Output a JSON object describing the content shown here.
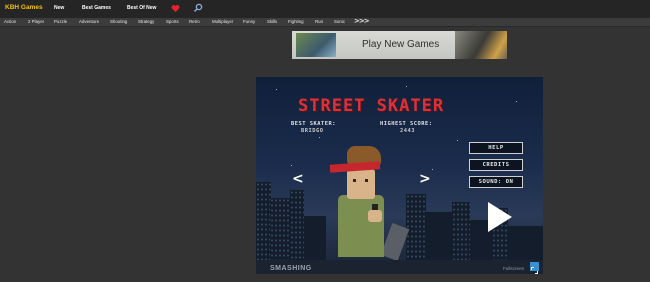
{
  "header": {
    "logo": "KBH Games",
    "nav": [
      {
        "label": "New"
      },
      {
        "label": "Best Games"
      },
      {
        "label": "Best Of New"
      }
    ],
    "favorites_icon": "heart-icon",
    "search_icon": "search-icon"
  },
  "categories": [
    "Action",
    "2 Player",
    "Puzzle",
    "Adventure",
    "Shooting",
    "Strategy",
    "Sports",
    "Retro",
    "Multiplayer",
    "Funny",
    "Skills",
    "Fighting",
    "Run",
    "Sonic"
  ],
  "more_icon": ">>>",
  "banner": {
    "text": "Play New Games"
  },
  "game": {
    "title": "STREET SKATER",
    "best_skater_label": "BEST SKATER:",
    "best_skater_value": "BRIDGO",
    "highest_score_label": "HIGHEST SCORE:",
    "highest_score_value": "2443",
    "prev_arrow": "<",
    "next_arrow": ">",
    "menu": [
      {
        "label": "HELP"
      },
      {
        "label": "CREDITS"
      },
      {
        "label": "SOUND: ON"
      }
    ],
    "play_icon": "play-icon",
    "publisher": "SMASHING",
    "fullscreen_label": "Fullscreen",
    "colors": {
      "title": "#d9333a",
      "sky": "#1b2c4d",
      "accent": "#3a8fd1"
    }
  },
  "colors": {
    "logo": "#f2c200",
    "background": "#333333",
    "topbar": "#252525"
  }
}
